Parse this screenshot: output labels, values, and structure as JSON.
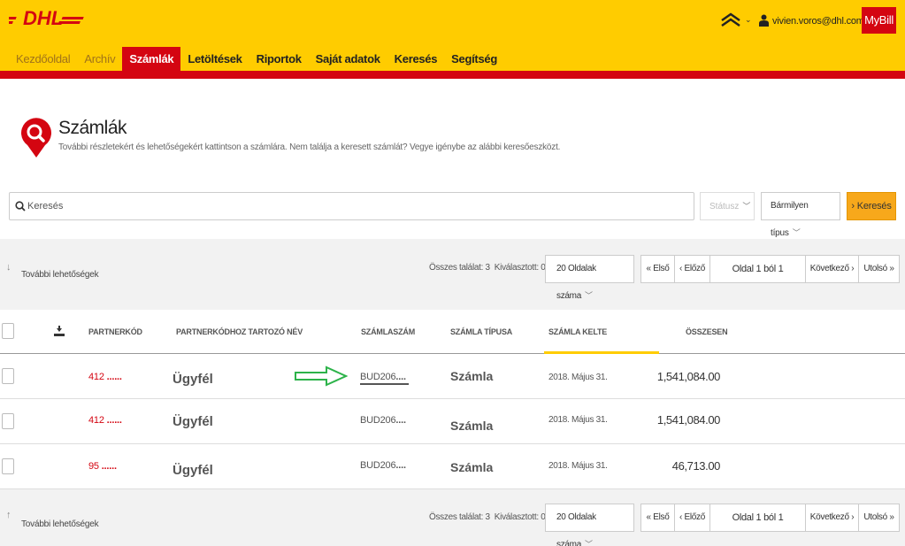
{
  "header": {
    "logo_text": "DHL",
    "user_email": "vivien.voros@dhl.com",
    "user_caret": "⌄",
    "switch_caret": "⌄",
    "mybill_label": "MyBill",
    "brand_yellow": "#ffcc00",
    "brand_red": "#d40511"
  },
  "nav": {
    "items": [
      {
        "label": "Kezdőoldal"
      },
      {
        "label": "Archív"
      },
      {
        "label": "Számlák"
      },
      {
        "label": "Letöltések"
      },
      {
        "label": "Riportok"
      },
      {
        "label": "Saját adatok"
      },
      {
        "label": "Keresés"
      },
      {
        "label": "Segítség"
      }
    ],
    "active": "Számlák"
  },
  "page": {
    "title": "Számlák",
    "subtitle": "További részletekért és lehetőségekért kattintson a számlára. Nem találja a keresett számlát? Vegye igénybe az alábbi keresőeszközt."
  },
  "search": {
    "placeholder": "Keresés",
    "status_label": "Státusz",
    "type_label": "Bármilyen típus",
    "button_label": "Keresés",
    "button_chevron": "›"
  },
  "toolbar": {
    "more_options": "További lehetőségek",
    "total_label": "Összes találat: 3",
    "selected_label": "Kiválasztott: 0",
    "per_page_label": "20 Oldalak száma",
    "first_label": "« Első",
    "prev_label": "‹ Előző",
    "page_label": "Oldal 1 ból 1",
    "next_label": "Következő ›",
    "last_label": "Utolsó »"
  },
  "table": {
    "columns": {
      "partner_code": "PARTNERKÓD",
      "partner_name": "PARTNERKÓDHOZ TARTOZÓ NÉV",
      "invoice_number": "SZÁMLASZÁM",
      "invoice_type": "SZÁMLA TÍPUSA",
      "invoice_date": "SZÁMLA KELTE",
      "total": "ÖSSZESEN"
    },
    "rows": [
      {
        "partner_code": "412",
        "mask": "......",
        "partner_name": "Ügyfél",
        "invoice_number": "BUD206",
        "inv_mask": "....",
        "invoice_type": "Számla",
        "invoice_date": "2018. Május 31.",
        "total": "1,541,084.00"
      },
      {
        "partner_code": "412",
        "mask": "......",
        "partner_name": "Ügyfél",
        "invoice_number": "BUD206",
        "inv_mask": "....",
        "invoice_type": "Számla",
        "invoice_date": "2018. Május 31.",
        "total": "1,541,084.00"
      },
      {
        "partner_code": "95",
        "mask": "......",
        "partner_name": "Ügyfél",
        "invoice_number": "BUD206",
        "inv_mask": "....",
        "invoice_type": "Számla",
        "invoice_date": "2018. Május 31.",
        "total": "46,713.00"
      }
    ]
  }
}
